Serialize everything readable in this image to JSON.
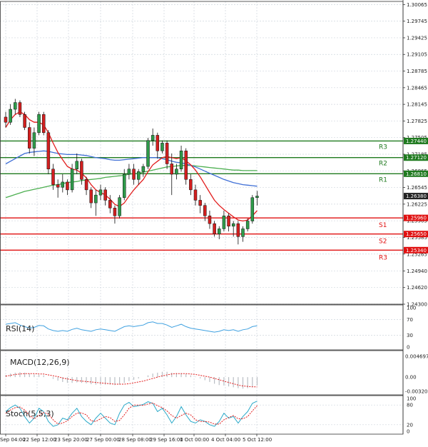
{
  "chart_data": {
    "type": "candlestick",
    "price_axis": {
      "ticks": [
        "1.30065",
        "1.29745",
        "1.29425",
        "1.29105",
        "1.28785",
        "1.28465",
        "1.28145",
        "1.27825",
        "1.27505",
        "1.27185",
        "1.26865",
        "1.26545",
        "1.26225",
        "1.25905",
        "1.25585",
        "1.25265",
        "1.24940",
        "1.24620",
        "1.24300"
      ],
      "range": [
        1.243,
        1.3022
      ]
    },
    "time_axis": {
      "ticks": [
        "Sep 04:00",
        "22 Sep 12:00",
        "23 Sep 20:00",
        "27 Sep 00:00",
        "28 Sep 08:00",
        "29 Sep 16:00",
        "1 Oct 00:00",
        "4 Oct 04:00",
        "5 Oct 12:00"
      ]
    },
    "levels": [
      {
        "name": "R3",
        "value": "1.27440",
        "kind": "resistance",
        "color": "#1f7a1f"
      },
      {
        "name": "R2",
        "value": "1.27120",
        "kind": "resistance",
        "color": "#1f7a1f"
      },
      {
        "name": "R1",
        "value": "1.26810",
        "kind": "resistance",
        "color": "#1f7a1f"
      },
      {
        "name": "S1",
        "value": "1.25960",
        "kind": "support",
        "color": "#e01010"
      },
      {
        "name": "S2",
        "value": "1.25650",
        "kind": "support",
        "color": "#e01010"
      },
      {
        "name": "R3",
        "value": "1.25340",
        "kind": "support",
        "color": "#e01010"
      }
    ],
    "current_price": {
      "value": "1.26380",
      "color": "#222222"
    },
    "candles": [
      [
        1.279,
        1.28,
        1.277,
        1.278
      ],
      [
        1.278,
        1.2815,
        1.2775,
        1.2805
      ],
      [
        1.2805,
        1.2825,
        1.2795,
        1.2818
      ],
      [
        1.2818,
        1.2822,
        1.279,
        1.2795
      ],
      [
        1.2795,
        1.28,
        1.2765,
        1.277
      ],
      [
        1.277,
        1.278,
        1.272,
        1.273
      ],
      [
        1.273,
        1.277,
        1.2715,
        1.276
      ],
      [
        1.276,
        1.28,
        1.2755,
        1.2795
      ],
      [
        1.2795,
        1.28,
        1.2755,
        1.276
      ],
      [
        1.276,
        1.2765,
        1.268,
        1.269
      ],
      [
        1.269,
        1.27,
        1.265,
        1.266
      ],
      [
        1.266,
        1.267,
        1.2635,
        1.2655
      ],
      [
        1.2655,
        1.268,
        1.2645,
        1.2665
      ],
      [
        1.2665,
        1.267,
        1.264,
        1.265
      ],
      [
        1.265,
        1.27,
        1.2645,
        1.269
      ],
      [
        1.269,
        1.272,
        1.268,
        1.2705
      ],
      [
        1.2705,
        1.271,
        1.266,
        1.267
      ],
      [
        1.267,
        1.2675,
        1.264,
        1.265
      ],
      [
        1.265,
        1.2655,
        1.2615,
        1.2625
      ],
      [
        1.2625,
        1.265,
        1.26,
        1.264
      ],
      [
        1.264,
        1.266,
        1.263,
        1.265
      ],
      [
        1.265,
        1.2655,
        1.262,
        1.263
      ],
      [
        1.263,
        1.264,
        1.2605,
        1.2615
      ],
      [
        1.2615,
        1.262,
        1.2585,
        1.26
      ],
      [
        1.26,
        1.264,
        1.2595,
        1.2635
      ],
      [
        1.2635,
        1.269,
        1.263,
        1.268
      ],
      [
        1.268,
        1.27,
        1.267,
        1.269
      ],
      [
        1.269,
        1.27,
        1.266,
        1.267
      ],
      [
        1.267,
        1.269,
        1.266,
        1.2685
      ],
      [
        1.2685,
        1.27,
        1.2675,
        1.2695
      ],
      [
        1.2695,
        1.275,
        1.269,
        1.2745
      ],
      [
        1.2745,
        1.2768,
        1.2735,
        1.2755
      ],
      [
        1.2755,
        1.276,
        1.271,
        1.2725
      ],
      [
        1.2725,
        1.2745,
        1.272,
        1.274
      ],
      [
        1.274,
        1.2745,
        1.269,
        1.27
      ],
      [
        1.27,
        1.272,
        1.264,
        1.268
      ],
      [
        1.268,
        1.27,
        1.267,
        1.269
      ],
      [
        1.269,
        1.2735,
        1.2685,
        1.2725
      ],
      [
        1.2725,
        1.273,
        1.266,
        1.267
      ],
      [
        1.267,
        1.268,
        1.264,
        1.265
      ],
      [
        1.265,
        1.266,
        1.262,
        1.263
      ],
      [
        1.263,
        1.264,
        1.2605,
        1.262
      ],
      [
        1.262,
        1.2625,
        1.259,
        1.26
      ],
      [
        1.26,
        1.261,
        1.2575,
        1.2585
      ],
      [
        1.2585,
        1.259,
        1.256,
        1.2565
      ],
      [
        1.2565,
        1.258,
        1.2555,
        1.2575
      ],
      [
        1.2575,
        1.261,
        1.257,
        1.26
      ],
      [
        1.26,
        1.2605,
        1.257,
        1.258
      ],
      [
        1.258,
        1.259,
        1.256,
        1.2585
      ],
      [
        1.2585,
        1.259,
        1.2545,
        1.256
      ],
      [
        1.256,
        1.258,
        1.255,
        1.2575
      ],
      [
        1.2575,
        1.2595,
        1.257,
        1.259
      ],
      [
        1.259,
        1.264,
        1.2585,
        1.2635
      ],
      [
        1.2635,
        1.2648,
        1.262,
        1.2638
      ]
    ],
    "ma_red": [
      1.277,
      1.2785,
      1.2795,
      1.28,
      1.2795,
      1.2785,
      1.278,
      1.278,
      1.2775,
      1.276,
      1.274,
      1.2722,
      1.2708,
      1.2695,
      1.269,
      1.2688,
      1.2682,
      1.2673,
      1.266,
      1.265,
      1.2645,
      1.264,
      1.2632,
      1.2622,
      1.2618,
      1.2625,
      1.2638,
      1.265,
      1.266,
      1.267,
      1.2685,
      1.2698,
      1.2705,
      1.2712,
      1.2714,
      1.2712,
      1.271,
      1.2712,
      1.2706,
      1.2698,
      1.2688,
      1.2675,
      1.266,
      1.2645,
      1.263,
      1.262,
      1.2612,
      1.2605,
      1.2598,
      1.2592,
      1.259,
      1.2592,
      1.26,
      1.261
    ],
    "ma_blue": [
      1.27,
      1.2705,
      1.271,
      1.2715,
      1.272,
      1.2722,
      1.2723,
      1.2724,
      1.2725,
      1.2724,
      1.2722,
      1.272,
      1.2719,
      1.2718,
      1.2718,
      1.2718,
      1.2717,
      1.2716,
      1.2714,
      1.2712,
      1.2711,
      1.271,
      1.2708,
      1.2707,
      1.2707,
      1.2708,
      1.2709,
      1.271,
      1.2711,
      1.2712,
      1.2712,
      1.2712,
      1.2712,
      1.271,
      1.2708,
      1.2705,
      1.2703,
      1.2702,
      1.27,
      1.2697,
      1.2694,
      1.269,
      1.2686,
      1.2682,
      1.2678,
      1.2674,
      1.267,
      1.2667,
      1.2664,
      1.2662,
      1.266,
      1.2659,
      1.2658,
      1.2657
    ],
    "ma_green": [
      1.2635,
      1.2638,
      1.2641,
      1.2644,
      1.2647,
      1.2649,
      1.2651,
      1.2653,
      1.2655,
      1.2657,
      1.2659,
      1.266,
      1.2662,
      1.2664,
      1.2665,
      1.2666,
      1.2668,
      1.2669,
      1.267,
      1.2671,
      1.2672,
      1.2674,
      1.2675,
      1.2676,
      1.2677,
      1.2678,
      1.268,
      1.2681,
      1.2682,
      1.2684,
      1.2686,
      1.2688,
      1.269,
      1.2692,
      1.2694,
      1.2695,
      1.2696,
      1.2697,
      1.2697,
      1.2697,
      1.2696,
      1.2695,
      1.2694,
      1.2693,
      1.2692,
      1.2691,
      1.269,
      1.2689,
      1.2688,
      1.2688,
      1.2687,
      1.2687,
      1.2687,
      1.2687
    ],
    "rsi": {
      "label": "RSI(14)",
      "ticks": [
        "100",
        "70",
        "30",
        "0"
      ],
      "values": [
        58,
        60,
        62,
        56,
        52,
        48,
        50,
        55,
        54,
        46,
        42,
        40,
        42,
        40,
        45,
        48,
        44,
        42,
        40,
        44,
        46,
        44,
        42,
        40,
        46,
        52,
        54,
        52,
        54,
        56,
        62,
        64,
        60,
        60,
        56,
        50,
        54,
        58,
        52,
        48,
        46,
        44,
        42,
        40,
        38,
        40,
        44,
        42,
        44,
        40,
        44,
        46,
        52,
        54
      ]
    },
    "macd": {
      "label": "MACD(12,26,9)",
      "ticks": [
        "0.004697",
        "0.00",
        "-0.003206"
      ],
      "hist": [
        0.0005,
        0.0008,
        0.001,
        0.0011,
        0.001,
        0.0008,
        0.0006,
        0.0005,
        0.0004,
        0.0,
        -0.0004,
        -0.0008,
        -0.0011,
        -0.0013,
        -0.0013,
        -0.0012,
        -0.0013,
        -0.0014,
        -0.0016,
        -0.0017,
        -0.0017,
        -0.0017,
        -0.0017,
        -0.0018,
        -0.0017,
        -0.0013,
        -0.0009,
        -0.0006,
        -0.0003,
        0.0,
        0.0004,
        0.0008,
        0.001,
        0.0012,
        0.0012,
        0.001,
        0.0009,
        0.0009,
        0.0007,
        0.0004,
        0.0001,
        -0.0003,
        -0.0007,
        -0.0011,
        -0.0015,
        -0.0018,
        -0.0019,
        -0.0021,
        -0.0023,
        -0.0025,
        -0.0026,
        -0.0025,
        -0.0022,
        -0.0019
      ],
      "signal": [
        0.0002,
        0.0004,
        0.0006,
        0.0007,
        0.0008,
        0.0008,
        0.0008,
        0.0007,
        0.0007,
        0.0005,
        0.0003,
        0.0001,
        -0.0002,
        -0.0004,
        -0.0006,
        -0.0008,
        -0.0009,
        -0.001,
        -0.0011,
        -0.0012,
        -0.0013,
        -0.0014,
        -0.0015,
        -0.0016,
        -0.0016,
        -0.0016,
        -0.0015,
        -0.0013,
        -0.0011,
        -0.0009,
        -0.0006,
        -0.0003,
        0.0,
        0.0003,
        0.0005,
        0.0007,
        0.0008,
        0.0008,
        0.0008,
        0.0007,
        0.0006,
        0.0004,
        0.0002,
        0.0,
        -0.0003,
        -0.0006,
        -0.0009,
        -0.0012,
        -0.0015,
        -0.0018,
        -0.002,
        -0.0021,
        -0.0022,
        -0.0022
      ]
    },
    "stoch": {
      "label": "Stoch(5,5,3)",
      "ticks": [
        "100",
        "80",
        "20",
        "0"
      ],
      "main": [
        60,
        72,
        80,
        70,
        45,
        25,
        40,
        70,
        60,
        30,
        15,
        20,
        40,
        35,
        55,
        70,
        45,
        30,
        20,
        40,
        55,
        40,
        25,
        20,
        55,
        80,
        88,
        75,
        78,
        82,
        90,
        85,
        60,
        70,
        50,
        25,
        45,
        75,
        50,
        30,
        25,
        35,
        30,
        20,
        15,
        30,
        55,
        40,
        45,
        25,
        45,
        60,
        85,
        92
      ],
      "signal": [
        55,
        65,
        72,
        74,
        65,
        48,
        38,
        48,
        57,
        52,
        35,
        22,
        25,
        32,
        45,
        55,
        56,
        50,
        32,
        30,
        38,
        45,
        42,
        30,
        33,
        50,
        70,
        80,
        80,
        79,
        83,
        86,
        78,
        72,
        62,
        48,
        40,
        48,
        55,
        50,
        35,
        30,
        30,
        28,
        22,
        22,
        35,
        42,
        48,
        38,
        38,
        45,
        62,
        78
      ]
    }
  }
}
